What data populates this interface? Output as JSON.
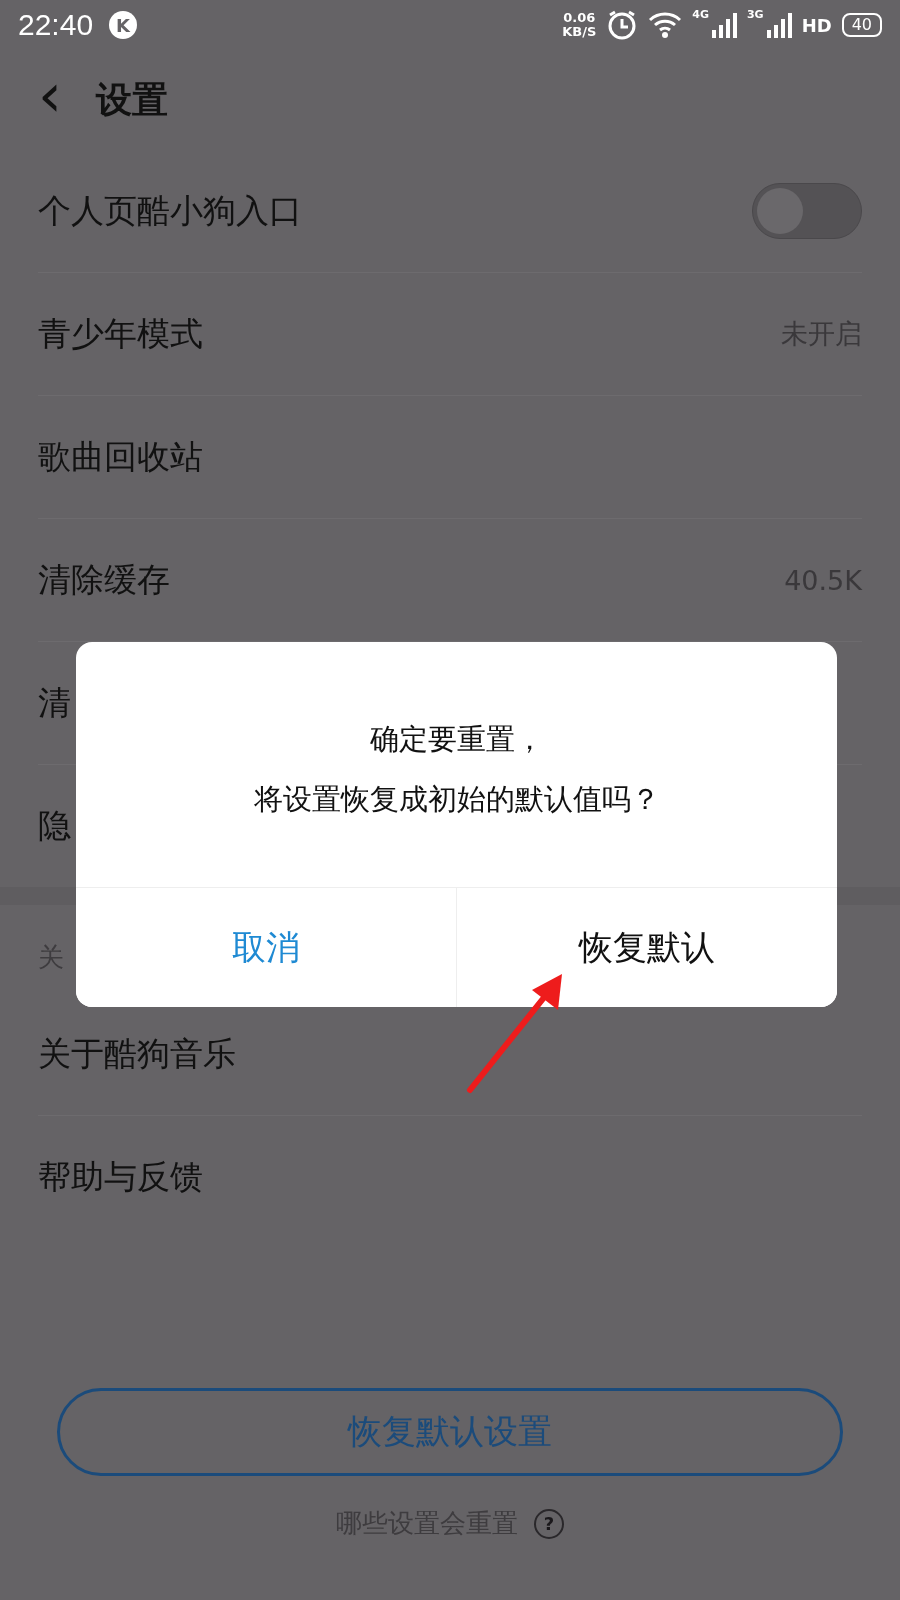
{
  "status_bar": {
    "time": "22:40",
    "badge": "K",
    "speed_value": "0.06",
    "speed_unit": "KB/S",
    "network_1": "4G",
    "network_2": "3G",
    "hd": "HD",
    "battery": "40"
  },
  "header": {
    "back": "‹",
    "title": "设置"
  },
  "rows": [
    {
      "kind": "toggle",
      "label": "个人页酷小狗入口",
      "on": false
    },
    {
      "kind": "value",
      "label": "青少年模式",
      "value": "未开启"
    },
    {
      "kind": "plain",
      "label": "歌曲回收站"
    },
    {
      "kind": "value",
      "label": "清除缓存",
      "value": "40.5K"
    },
    {
      "kind": "plain",
      "label": "清"
    },
    {
      "kind": "plain",
      "label": "隐"
    }
  ],
  "section": {
    "label": "关",
    "rows": [
      {
        "label": "关于酷狗音乐"
      },
      {
        "label": "帮助与反馈"
      }
    ]
  },
  "reset_button": "恢复默认设置",
  "reset_hint": "哪些设置会重置",
  "help_icon": "?",
  "dialog": {
    "message_lines": [
      "确定要重置，",
      "将设置恢复成初始的默认值吗？"
    ],
    "cancel": "取消",
    "confirm": "恢复默认"
  }
}
